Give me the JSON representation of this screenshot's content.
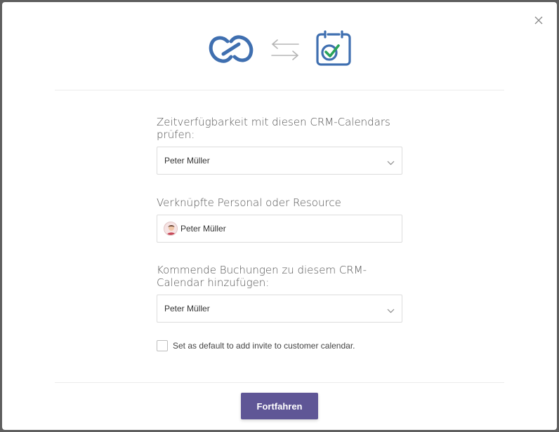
{
  "dialog": {
    "close_label": "Close",
    "fields": {
      "check_availability": {
        "label": "Zeitverfügbarkeit mit diesen CRM-Calendars prüfen:",
        "value": "Peter Müller"
      },
      "linked_personal": {
        "label": "Verknüpfte Personal oder Resource",
        "value": "Peter Müller"
      },
      "upcoming_bookings": {
        "label": "Kommende Buchungen zu diesem CRM-Calendar hinzufügen:",
        "value": "Peter Müller"
      }
    },
    "default_invite": {
      "label": "Set as default to add invite to customer calendar.",
      "checked": false
    },
    "continue_label": "Fortfahren"
  },
  "colors": {
    "accent": "#5f5696",
    "link_blue": "#3f6fb0",
    "check_green": "#2aa35a"
  },
  "icons": {
    "left": "zoho-crm-link-icon",
    "middle": "sync-arrows-icon",
    "right": "calendar-check-icon"
  }
}
